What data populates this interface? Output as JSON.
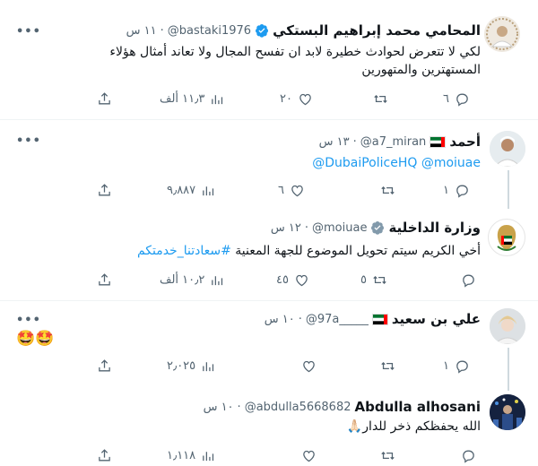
{
  "tweets": [
    {
      "name": "المحامي محمد إبراهيم البستكي",
      "handle": "@bastaki1976",
      "time": "١١ س",
      "text_line1": "لكي لا تتعرض لحوادث خطيرة لابد ان تفسح المجال ولا تعاند أمثال هؤلاء",
      "text_line2": "المستهترين والمتهورين",
      "replies": "٦",
      "retweets": "",
      "likes": "٢٠",
      "views": "١١٫٣ ألف"
    },
    {
      "name": "أحمد",
      "handle": "@a7_miran",
      "time": "١٣ س",
      "text_mentions": "@DubaiPoliceHQ @moiuae",
      "replies": "١",
      "retweets": "",
      "likes": "٦",
      "views": "٩٫٨٨٧"
    },
    {
      "name": "وزارة الداخلية",
      "handle": "@moiuae",
      "time": "١٢ س",
      "text_plain": "أخي الكريم سيتم تحويل الموضوع للجهة المعنية ",
      "text_hashtag": "#سعادتنا_خدمتكم",
      "replies": "",
      "retweets": "٥",
      "likes": "٤٥",
      "views": "١٠٫٢ ألف"
    },
    {
      "name": "علي بن سعيد",
      "handle": "@97a_____",
      "time": "١٠ س",
      "emoji": "🤩🤩",
      "replies": "١",
      "retweets": "",
      "likes": "",
      "views": "٢٫٠٢٥"
    },
    {
      "name": "Abdulla alhosani",
      "handle": "@abdulla5668682",
      "time": "١٠ س",
      "text": "الله يحفظكم ذخر للدار🙏🏻",
      "replies": "",
      "retweets": "",
      "likes": "",
      "views": "١٫١١٨"
    }
  ],
  "colors": {
    "text": "#0f1419",
    "muted": "#536471",
    "link": "#1d9bf0",
    "verified": "#1d9bf0",
    "divider": "#eff3f4"
  },
  "icons": [
    "more-icon",
    "verified-badge-icon",
    "reply-icon",
    "retweet-icon",
    "like-icon",
    "views-icon",
    "share-icon",
    "uae-flag-icon"
  ]
}
